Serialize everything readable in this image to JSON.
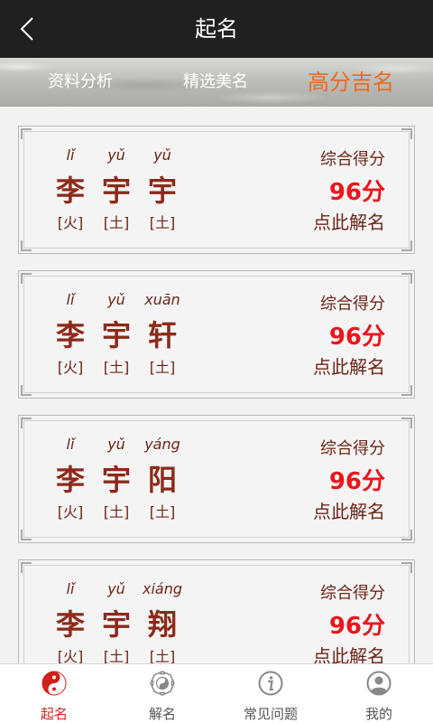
{
  "header": {
    "title": "起名"
  },
  "tabs": [
    {
      "label": "资料分析",
      "active": false
    },
    {
      "label": "精选美名",
      "active": false
    },
    {
      "label": "高分吉名",
      "active": true
    }
  ],
  "cards": [
    {
      "chars": [
        {
          "pinyin": "lǐ",
          "hanzi": "李",
          "wuxing": "[火]"
        },
        {
          "pinyin": "yǔ",
          "hanzi": "宇",
          "wuxing": "[土]"
        },
        {
          "pinyin": "yǔ",
          "hanzi": "宇",
          "wuxing": "[土]"
        }
      ],
      "score_label": "综合得分",
      "score": "96分",
      "action": "点此解名"
    },
    {
      "chars": [
        {
          "pinyin": "lǐ",
          "hanzi": "李",
          "wuxing": "[火]"
        },
        {
          "pinyin": "yǔ",
          "hanzi": "宇",
          "wuxing": "[土]"
        },
        {
          "pinyin": "xuān",
          "hanzi": "轩",
          "wuxing": "[土]"
        }
      ],
      "score_label": "综合得分",
      "score": "96分",
      "action": "点此解名"
    },
    {
      "chars": [
        {
          "pinyin": "lǐ",
          "hanzi": "李",
          "wuxing": "[火]"
        },
        {
          "pinyin": "yǔ",
          "hanzi": "宇",
          "wuxing": "[土]"
        },
        {
          "pinyin": "yáng",
          "hanzi": "阳",
          "wuxing": "[土]"
        }
      ],
      "score_label": "综合得分",
      "score": "96分",
      "action": "点此解名"
    },
    {
      "chars": [
        {
          "pinyin": "lǐ",
          "hanzi": "李",
          "wuxing": "[火]"
        },
        {
          "pinyin": "yǔ",
          "hanzi": "宇",
          "wuxing": "[土]"
        },
        {
          "pinyin": "xiáng",
          "hanzi": "翔",
          "wuxing": "[土]"
        }
      ],
      "score_label": "综合得分",
      "score": "96分",
      "action": "点此解名"
    }
  ],
  "bottom_nav": [
    {
      "label": "起名",
      "icon": "yin-yang-icon",
      "active": true
    },
    {
      "label": "解名",
      "icon": "bagua-icon",
      "active": false
    },
    {
      "label": "常见问题",
      "icon": "info-icon",
      "active": false
    },
    {
      "label": "我的",
      "icon": "user-icon",
      "active": false
    }
  ],
  "colors": {
    "accent": "#ee6a1e",
    "score": "#e8171c",
    "hanzi": "#8c2a1a",
    "nav_active": "#d0211b"
  }
}
